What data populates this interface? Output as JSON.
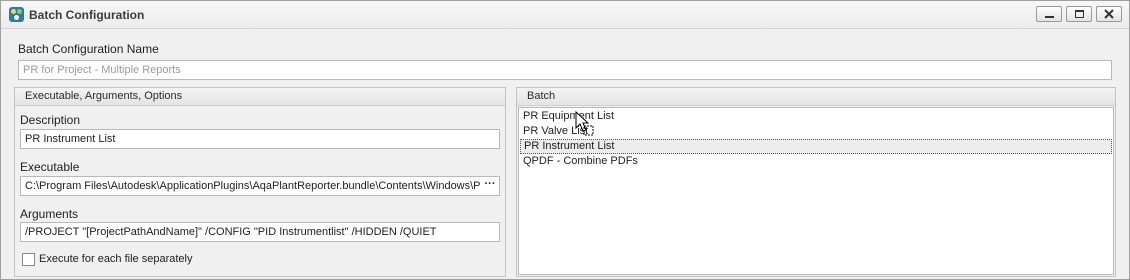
{
  "window": {
    "title": "Batch Configuration",
    "controls": [
      "minimize",
      "maximize",
      "close"
    ]
  },
  "config_name": {
    "label": "Batch Configuration Name",
    "placeholder": "PR for Project - Multiple Reports"
  },
  "left_panel": {
    "header": "Executable, Arguments, Options",
    "description": {
      "label": "Description",
      "value": "PR Instrument List"
    },
    "executable": {
      "label": "Executable",
      "value": "C:\\Program Files\\Autodesk\\ApplicationPlugins\\AqaPlantReporter.bundle\\Contents\\Windows\\Pla",
      "browse_label": "···"
    },
    "arguments": {
      "label": "Arguments",
      "value": "/PROJECT \"[ProjectPathAndName]\" /CONFIG \"PID Instrumentlist\" /HIDDEN /QUIET"
    },
    "checkbox": {
      "label": "Execute for each file separately",
      "checked": false
    }
  },
  "right_panel": {
    "header": "Batch",
    "items": [
      {
        "label": "PR Equipment List",
        "selected": false
      },
      {
        "label": "PR Valve List",
        "selected": false
      },
      {
        "label": "PR Instrument List",
        "selected": true
      },
      {
        "label": "QPDF - Combine PDFs",
        "selected": false
      }
    ]
  },
  "icons": {
    "app": "app-icon",
    "cursor": "drag-move-cursor-icon"
  }
}
